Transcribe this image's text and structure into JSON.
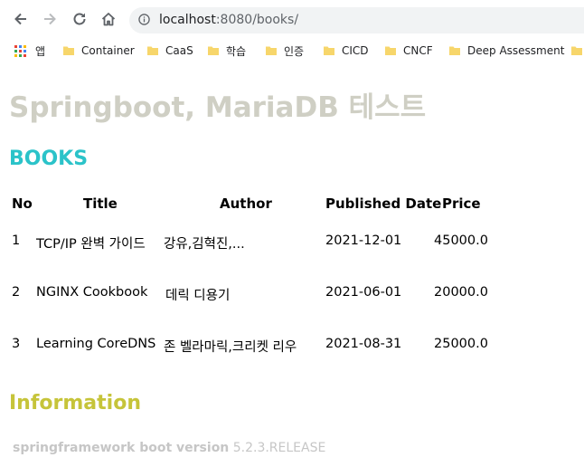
{
  "browser": {
    "url_host": "localhost",
    "url_rest": ":8080/books/"
  },
  "bookmarks": {
    "apps_label": "앱",
    "items": [
      "Container",
      "CaaS",
      "학습",
      "인증",
      "CICD",
      "CNCF",
      "Deep Assessment"
    ]
  },
  "page": {
    "title": "Springboot, MariaDB 테스트",
    "books_heading": "BOOKS",
    "table": {
      "headers": [
        "No",
        "Title",
        "Author",
        "Published Date",
        "Price"
      ],
      "rows": [
        [
          "1",
          "TCP/IP 완벽 가이드",
          "강유,김혁진,...",
          "2021-12-01",
          "45000.0"
        ],
        [
          "2",
          "NGINX Cookbook",
          "데릭 디용기",
          "2021-06-01",
          "20000.0"
        ],
        [
          "3",
          "Learning CoreDNS",
          "존 벨라마릭,크리켓 리우",
          "2021-08-31",
          "25000.0"
        ]
      ]
    },
    "info_heading": "Information",
    "version_label": "springframework boot version",
    "version_value": "5.2.3.RELEASE"
  },
  "colors": {
    "title": "#cfcfc4",
    "books_heading": "#2bc3c9",
    "info_heading": "#c6c43a",
    "folder": "#f7d66b"
  },
  "icons": [
    "back-arrow-icon",
    "forward-arrow-icon",
    "reload-icon",
    "home-icon",
    "info-icon",
    "apps-grid-icon",
    "folder-icon"
  ]
}
